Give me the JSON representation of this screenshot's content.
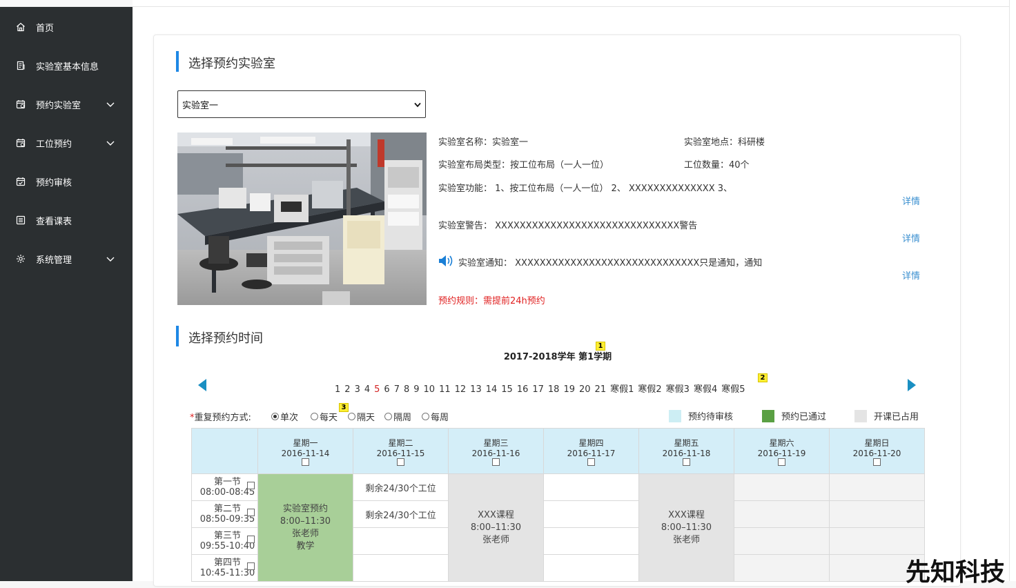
{
  "sidebar": {
    "items": [
      {
        "label": "首页",
        "icon": "home-icon"
      },
      {
        "label": "实验室基本信息",
        "icon": "document-icon"
      },
      {
        "label": "预约实验室",
        "icon": "calendar-check-icon"
      },
      {
        "label": "工位预约",
        "icon": "calendar-check-icon"
      },
      {
        "label": "预约审核",
        "icon": "calendar-icon"
      },
      {
        "label": "查看课表",
        "icon": "list-icon"
      },
      {
        "label": "系统管理",
        "icon": "gear-icon"
      }
    ]
  },
  "lab_section": {
    "title": "选择预约实验室",
    "selected_lab": "实验室一",
    "name": "实验室名称：实验室一",
    "location": "实验室地点：科研楼",
    "layout_type": "实验室布局类型：按工位布局（一人一位）",
    "seat_count": "工位数量：40个",
    "function": "实验室功能：  1、按工位布局（一人一位） 2、  XXXXXXXXXXXXXX  3、",
    "warning": "实验室警告：  XXXXXXXXXXXXXXXXXXXXXXXXXXXXXX警告",
    "notice": "实验室通知：  XXXXXXXXXXXXXXXXXXXXXXXXXXXXXX只是通知，通知",
    "detail_label": "详情",
    "rule": "预约规则：需提前24h预约"
  },
  "time_section": {
    "title": "选择预约时间",
    "term": "2017-2018学年 第1学期",
    "badges": [
      "1",
      "2",
      "3"
    ],
    "weeks": [
      "1",
      "2",
      "3",
      "4",
      "5",
      "6",
      "7",
      "8",
      "9",
      "10",
      "11",
      "12",
      "13",
      "14",
      "15",
      "16",
      "17",
      "18",
      "19",
      "20",
      "21",
      "寒假1",
      "寒假2",
      "寒假3",
      "寒假4",
      "寒假5"
    ],
    "current_week": "5",
    "repeat_label": "重复预约方式:",
    "repeat_required_mark": "*",
    "repeat_options": [
      "单次",
      "每天",
      "隔天",
      "隔周",
      "每周"
    ],
    "repeat_selected": "单次",
    "legend": [
      {
        "label": "预约待审核",
        "color": "#cdeef4"
      },
      {
        "label": "预约已通过",
        "color": "#5aa043"
      },
      {
        "label": "开课已占用",
        "color": "#e4e4e4"
      }
    ]
  },
  "schedule": {
    "days": [
      {
        "name": "星期一",
        "date": "2016-11-14"
      },
      {
        "name": "星期二",
        "date": "2016-11-15"
      },
      {
        "name": "星期三",
        "date": "2016-11-16"
      },
      {
        "name": "星期四",
        "date": "2016-11-17"
      },
      {
        "name": "星期五",
        "date": "2016-11-18"
      },
      {
        "name": "星期六",
        "date": "2016-11-19"
      },
      {
        "name": "星期日",
        "date": "2016-11-20"
      }
    ],
    "periods": [
      {
        "name": "第一节",
        "time": "08:00-08:45"
      },
      {
        "name": "第二节",
        "time": "08:50-09:35"
      },
      {
        "name": "第三节",
        "time": "09:55-10:40"
      },
      {
        "name": "第四节",
        "time": "10:45-11:30"
      }
    ],
    "mon_booking": {
      "l1": "实验室预约",
      "l2": "8:00–11:30",
      "l3": "张老师",
      "l4": "教学"
    },
    "tue_rows": [
      "剩余24/30个工位",
      "剩余24/30个工位"
    ],
    "wed_course": {
      "l1": "XXX课程",
      "l2": "8:00–11:30",
      "l3": "张老师"
    },
    "fri_course": {
      "l1": "XXX课程",
      "l2": "8:00–11:30",
      "l3": "张老师"
    }
  },
  "watermark": "先知科技"
}
